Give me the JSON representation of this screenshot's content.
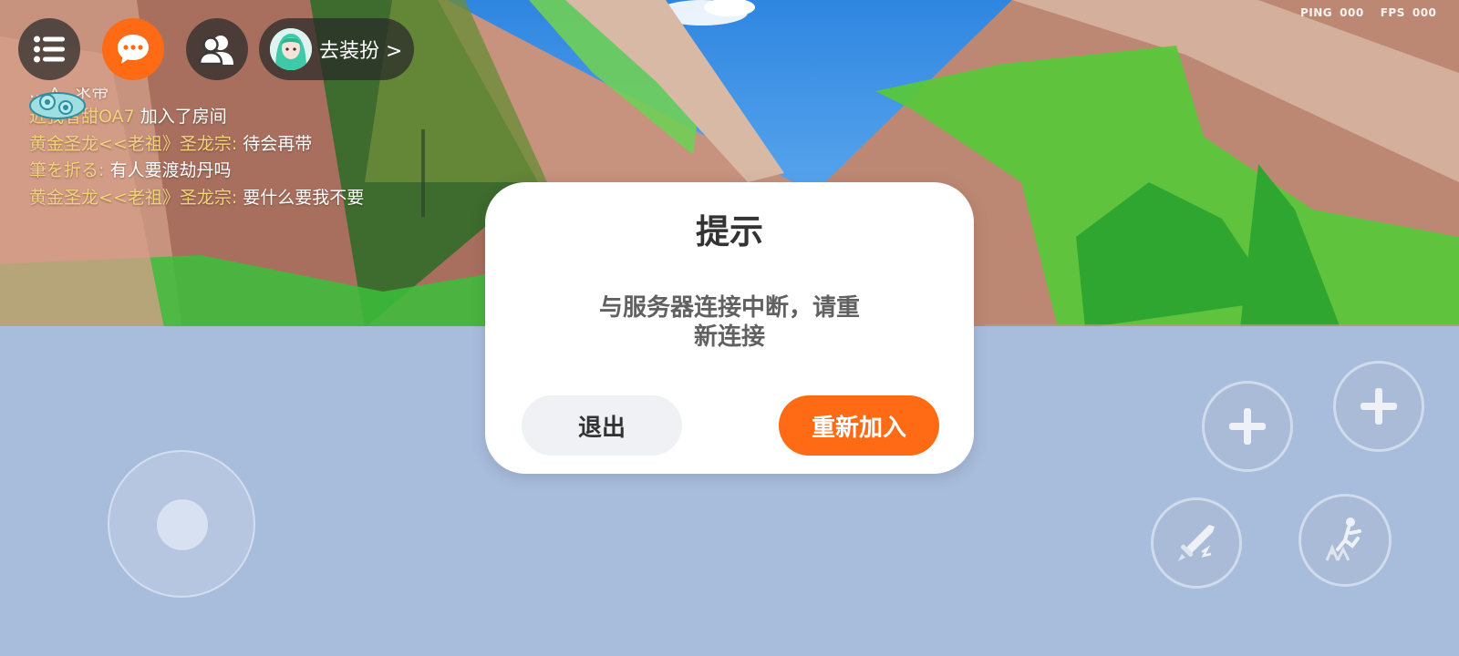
{
  "hud": {
    "perf": {
      "ping_label": "PING",
      "ping_value": "000",
      "fps_label": "FPS",
      "fps_value": "000"
    },
    "dressup_label": "去装扮 >"
  },
  "chat": {
    "partial_line": "...入. 求带",
    "lines": [
      {
        "who": "近我者甜OA7",
        "msg": "加入了房间"
      },
      {
        "who": "黄金圣龙<<老祖》圣龙宗:",
        "msg": "待会再带"
      },
      {
        "who": "筆を折る:",
        "msg": "有人要渡劫丹吗"
      },
      {
        "who": "黄金圣龙<<老祖》圣龙宗:",
        "msg": "要什么要我不要"
      }
    ]
  },
  "dialog": {
    "title": "提示",
    "message": "与服务器连接中断，请重新连接",
    "exit_label": "退出",
    "rejoin_label": "重新加入"
  },
  "colors": {
    "accent": "#ff6a14",
    "dialog_bg": "#ffffff",
    "chat_name": "#f4d27a",
    "floor": "#a8bcdc"
  },
  "icons": {
    "menu": "list-icon",
    "chat": "chat-bubble-icon",
    "friends": "friends-icon",
    "action_1": "plus-icon",
    "action_2": "plus-icon",
    "attack": "sword-icon",
    "jump": "jump-icon"
  }
}
